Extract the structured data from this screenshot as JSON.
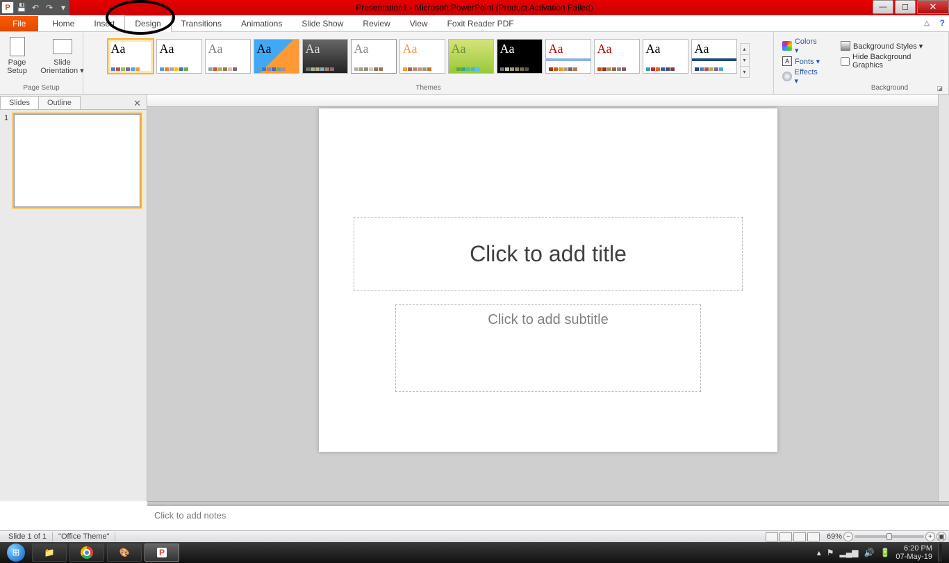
{
  "title": "Presentation1  -  Microsoft PowerPoint (Product Activation Failed)",
  "tabs": {
    "file": "File",
    "home": "Home",
    "insert": "Insert",
    "design": "Design",
    "transitions": "Transitions",
    "animations": "Animations",
    "slideshow": "Slide Show",
    "review": "Review",
    "view": "View",
    "foxit": "Foxit Reader PDF"
  },
  "groups": {
    "pagesetup": {
      "label": "Page Setup",
      "page_setup_btn": "Page\nSetup",
      "orientation_btn": "Slide\nOrientation ▾"
    },
    "themes": {
      "label": "Themes"
    },
    "variants": {
      "colors": "Colors ▾",
      "fonts": "Fonts ▾",
      "effects": "Effects ▾"
    },
    "background": {
      "label": "Background",
      "styles": "Background Styles ▾",
      "hide": "Hide Background Graphics"
    }
  },
  "themes_gallery": [
    {
      "aa_color": "#000",
      "bg": "#ffffff",
      "swatches": [
        "#4f81bd",
        "#c0504d",
        "#9bbb59",
        "#8064a2",
        "#4bacc6",
        "#f79646"
      ],
      "selected": true
    },
    {
      "aa_color": "#000",
      "bg": "#ffffff",
      "swatches": [
        "#5b9bd5",
        "#ed7d31",
        "#a5a5a5",
        "#ffc000",
        "#4472c4",
        "#70ad47"
      ]
    },
    {
      "aa_color": "#808080",
      "bg": "#ffffff",
      "swatches": [
        "#93a299",
        "#cf543f",
        "#b5ae53",
        "#848058",
        "#e8b7b7",
        "#786c71"
      ]
    },
    {
      "aa_color": "#000",
      "bg": "linear-gradient(135deg,#3fa9f5 50%,#ff9933 50%)",
      "swatches": [
        "#629dd1",
        "#297fd5",
        "#7f8fa9",
        "#4a66ac",
        "#5aa2ae",
        "#9d90a0"
      ]
    },
    {
      "aa_color": "#ddd",
      "bg": "linear-gradient(#666,#222)",
      "swatches": [
        "#6f6f74",
        "#a7b789",
        "#beae98",
        "#92a9b9",
        "#9c8265",
        "#8d6974"
      ]
    },
    {
      "aa_color": "#888",
      "bg": "#ffffff",
      "swatches": [
        "#b0b0b0",
        "#a6a57a",
        "#968c8c",
        "#d0ccb9",
        "#897b61",
        "#8f7a5b"
      ],
      "border": "#999"
    },
    {
      "aa_color": "#f79646",
      "bg": "#ffffff",
      "swatches": [
        "#f0a22e",
        "#a5644e",
        "#b58b80",
        "#c3986d",
        "#a19574",
        "#c17529"
      ]
    },
    {
      "aa_color": "#6a8f3c",
      "bg": "linear-gradient(#d7e27a,#98c93c)",
      "swatches": [
        "#99cb38",
        "#63a537",
        "#37a76f",
        "#44c1a3",
        "#4eb3cf",
        "#51c3f9"
      ]
    },
    {
      "aa_color": "#fff",
      "bg": "#000",
      "swatches": [
        "#6f6f74",
        "#bfbfa5",
        "#a09781",
        "#8f8b66",
        "#766a50",
        "#5a5446"
      ]
    },
    {
      "aa_color": "#c00000",
      "bg": "#ffffff",
      "swatches": [
        "#a5300f",
        "#d55816",
        "#e19825",
        "#b19c7d",
        "#7f5f52",
        "#b27d49"
      ],
      "accent_bar": "#8db3e2"
    },
    {
      "aa_color": "#c00000",
      "bg": "#ffffff",
      "swatches": [
        "#d34817",
        "#9b2d1f",
        "#a28e6a",
        "#956251",
        "#918485",
        "#855d5d"
      ]
    },
    {
      "aa_color": "#000",
      "bg": "#ffffff",
      "swatches": [
        "#2da2bf",
        "#da1f28",
        "#eb641b",
        "#39639d",
        "#474b78",
        "#7d3c4a"
      ]
    },
    {
      "aa_color": "#000",
      "bg": "#ffffff",
      "swatches": [
        "#1f497d",
        "#4f81bd",
        "#c0504d",
        "#9bbb59",
        "#8064a2",
        "#4bacc6"
      ],
      "accent_bar": "#1f497d"
    }
  ],
  "slidepanel": {
    "slides_tab": "Slides",
    "outline_tab": "Outline",
    "slide_number": "1"
  },
  "canvas": {
    "title_placeholder": "Click to add title",
    "subtitle_placeholder": "Click to add subtitle"
  },
  "notes": {
    "placeholder": "Click to add notes"
  },
  "status": {
    "slide": "Slide 1 of 1",
    "theme": "\"Office Theme\"",
    "zoom": "69%"
  },
  "taskbar": {
    "time": "6:20 PM",
    "date": "07-May-19"
  }
}
